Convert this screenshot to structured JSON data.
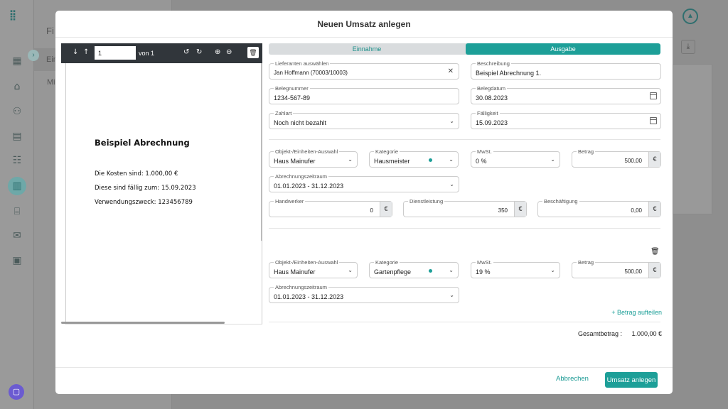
{
  "modal": {
    "title": "Neuen Umsatz anlegen",
    "cancel_label": "Abbrechen",
    "create_label": "Umsatz anlegen"
  },
  "background": {
    "panel_title": "Fi",
    "panel_item_active": "Ein",
    "panel_item_2": "Mi"
  },
  "pdf_viewer": {
    "page_value": "1",
    "page_of": "von 1",
    "heading": "Beispiel Abrechnung",
    "lines": [
      "Die Kosten sind: 1.000,00 €",
      "Diese sind fällig zum: 15.09.2023",
      "Verwendungszweck: 123456789"
    ]
  },
  "form": {
    "toggle": {
      "income": "Einnahme",
      "expense": "Ausgabe",
      "selected": "Ausgabe"
    },
    "supplier": {
      "label": "Lieferanten auswählen",
      "value": "Jan Hoffmann (70003/10003)"
    },
    "description": {
      "label": "Beschreibung",
      "value": "Beispiel Abrechnung 1."
    },
    "receipt_number": {
      "label": "Belegnummer",
      "value": "1234-567-89"
    },
    "receipt_date": {
      "label": "Belegdatum",
      "value": "30.08.2023"
    },
    "payment_type": {
      "label": "Zahlart",
      "value": "Noch nicht bezahlt"
    },
    "due_date": {
      "label": "Fälligkeit",
      "value": "15.09.2023"
    },
    "positions": [
      {
        "object": {
          "label": "Objekt-/Einheiten-Auswahl",
          "value": "Haus Mainufer"
        },
        "category": {
          "label": "Kategorie",
          "value": "Hausmeister"
        },
        "vat": {
          "label": "MwSt.",
          "value": "0 %"
        },
        "amount": {
          "label": "Betrag",
          "value": "500,00",
          "currency": "€"
        },
        "period": {
          "label": "Abrechnungszeitraum",
          "value": "01.01.2023 - 31.12.2023"
        },
        "craftsman": {
          "label": "Handwerker",
          "value": "0",
          "currency": "€"
        },
        "service": {
          "label": "Dienstleistung",
          "value": "350",
          "currency": "€"
        },
        "employment": {
          "label": "Beschäftigung",
          "value": "0,00",
          "currency": "€"
        }
      },
      {
        "object": {
          "label": "Objekt-/Einheiten-Auswahl",
          "value": "Haus Mainufer"
        },
        "category": {
          "label": "Kategorie",
          "value": "Gartenpflege"
        },
        "vat": {
          "label": "MwSt.",
          "value": "19 %"
        },
        "amount": {
          "label": "Betrag",
          "value": "500,00",
          "currency": "€"
        },
        "period": {
          "label": "Abrechnungszeitraum",
          "value": "01.01.2023 - 31.12.2023"
        }
      }
    ],
    "split_link": "+ Betrag aufteilen",
    "total_label": "Gesamtbetrag :",
    "total_value": "1.000,00 €"
  },
  "colors": {
    "accent": "#1d9f98",
    "toolbar": "#31363b"
  },
  "icons": [
    "arrow-down-icon",
    "arrow-up-icon",
    "rotate-left-icon",
    "rotate-right-icon",
    "zoom-in-icon",
    "zoom-out-icon",
    "trash-icon",
    "chevron-down-icon",
    "calendar-icon",
    "clear-icon",
    "euro-icon"
  ]
}
